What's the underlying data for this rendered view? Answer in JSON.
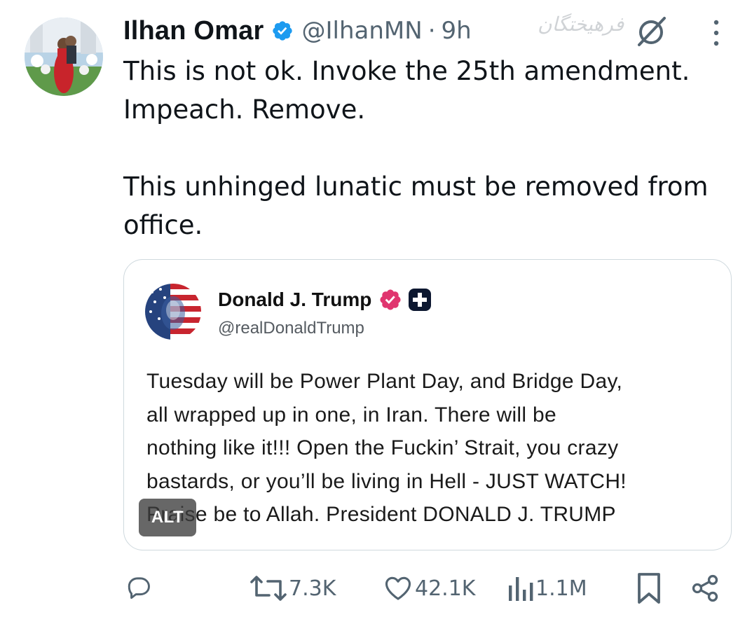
{
  "author": {
    "display_name": "Ilhan Omar",
    "handle": "@IlhanMN",
    "separator": "·",
    "time": "9h"
  },
  "watermark_text": "فرهیختگان",
  "tweet": {
    "text": "This is not ok. Invoke the 25th amendment.\nImpeach. Remove.\n\nThis unhinged lunatic must be removed from\noffice."
  },
  "quoted": {
    "display_name": "Donald J. Trump",
    "handle": "@realDonaldTrump",
    "lines": [
      "Tuesday will be Power Plant Day, and Bridge Day,",
      "all wrapped up in one, in Iran. There will be",
      "nothing like it!!! Open the Fuckin’ Strait, you crazy",
      "bastards, or you’ll be living in Hell - JUST WATCH!",
      "Praise be to Allah. President DONALD J. TRUMP"
    ],
    "alt_label": "ALT"
  },
  "actions": {
    "reposts": "7.3K",
    "likes": "42.1K",
    "views": "1.1M"
  },
  "colors": {
    "verified_blue": "#1d9bf0",
    "secondary_text": "#536471",
    "truth_badge_pink": "#e0356f",
    "border": "#cfd9de"
  },
  "icons": {
    "verified": "verified-badge-icon",
    "grok": "grok-icon",
    "more": "more-options-icon",
    "reply": "reply-icon",
    "repost": "repost-icon",
    "like": "like-icon",
    "views": "views-icon",
    "bookmark": "bookmark-icon",
    "share": "share-icon"
  }
}
